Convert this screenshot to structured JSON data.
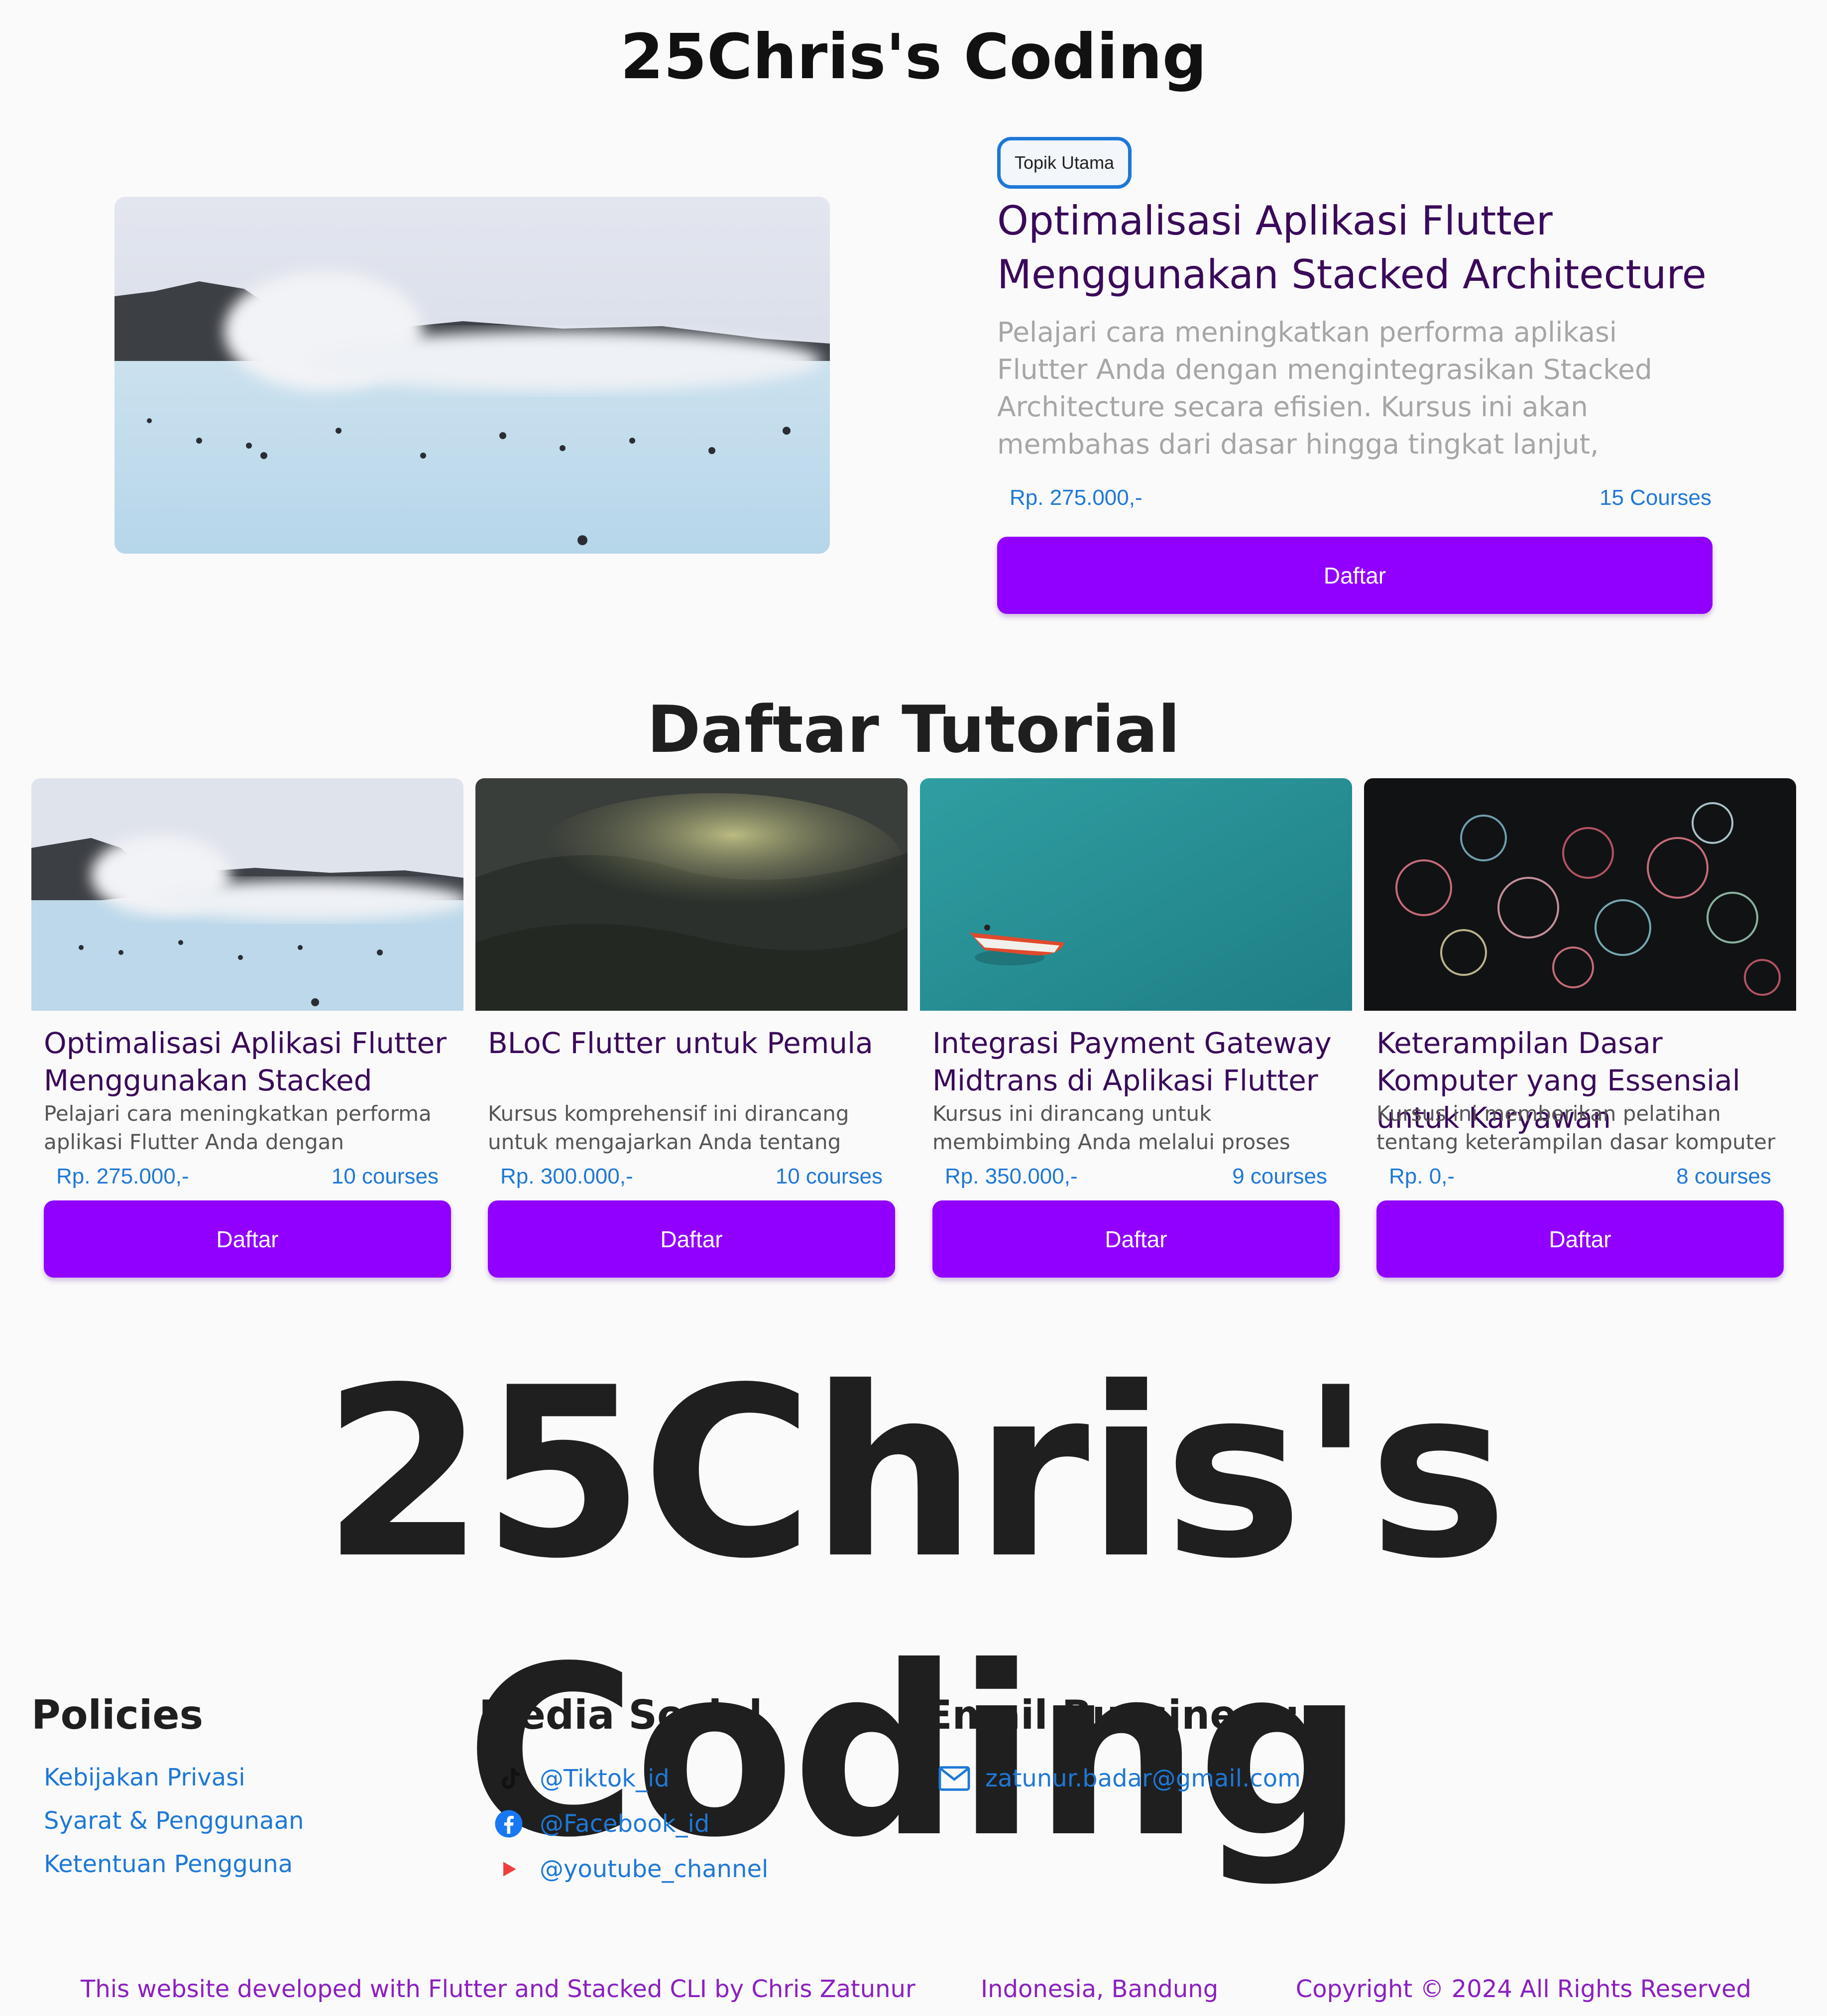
{
  "header": {
    "title": "25Chris's Coding"
  },
  "hero": {
    "tag": "Topik Utama",
    "title": "Optimalisasi Aplikasi Flutter Menggunakan Stacked Architecture",
    "description": "Pelajari cara meningkatkan performa aplikasi Flutter Anda dengan mengintegrasikan Stacked Architecture secara efisien. Kursus ini akan membahas dari dasar hingga tingkat lanjut, termasuk manajemen state dan",
    "price": "Rp. 275.000,-",
    "courses": "15 Courses",
    "button": "Daftar"
  },
  "tutorials": {
    "title": "Daftar Tutorial",
    "cards": [
      {
        "title": "Optimalisasi Aplikasi Flutter Menggunakan Stacked",
        "desc": "Pelajari cara meningkatkan performa aplikasi Flutter Anda dengan",
        "price": "Rp. 275.000,-",
        "courses": "10 courses",
        "button": "Daftar"
      },
      {
        "title": "BLoC Flutter untuk Pemula",
        "desc": "Kursus komprehensif ini dirancang untuk mengajarkan Anda tentang Business Logic",
        "price": "Rp. 300.000,-",
        "courses": "10 courses",
        "button": "Daftar"
      },
      {
        "title": "Integrasi Payment Gateway Midtrans di Aplikasi Flutter",
        "desc": "Kursus ini dirancang untuk membimbing Anda melalui proses integrasi gateway",
        "price": "Rp. 350.000,-",
        "courses": "9 courses",
        "button": "Daftar"
      },
      {
        "title": "Keterampilan Dasar Komputer yang Essensial untuk Karyawan",
        "desc": "Kursus ini memberikan pelatihan tentang keterampilan dasar komputer yang",
        "price": "Rp. 0,-",
        "courses": "8 courses",
        "button": "Daftar"
      }
    ]
  },
  "brand": {
    "big": "25Chris's Coding"
  },
  "footer": {
    "policies": {
      "title": "Policies",
      "links": [
        "Kebijakan Privasi",
        "Syarat & Penggunaan",
        "Ketentuan Pengguna"
      ]
    },
    "social": {
      "title": "Media Sosial",
      "items": [
        {
          "label": "@Tiktok_id",
          "icon": "tiktok-icon"
        },
        {
          "label": "@Facebook_id",
          "icon": "facebook-icon"
        },
        {
          "label": "@youtube_channel",
          "icon": "youtube-icon"
        }
      ]
    },
    "email": {
      "title": "Email Bussiness:",
      "address": "zatunur.badar@gmail.com",
      "icon": "mail-icon"
    },
    "bottom": {
      "credit": "This website developed with Flutter and Stacked CLI by Chris Zatunur",
      "location": "Indonesia, Bandung",
      "copyright": "Copyright © 2024 All Rights Reserved"
    }
  },
  "colors": {
    "accent": "#9100ff",
    "link": "#1e78d6",
    "title": "#3a0a5a",
    "bottom_text": "#8b1fc0"
  }
}
